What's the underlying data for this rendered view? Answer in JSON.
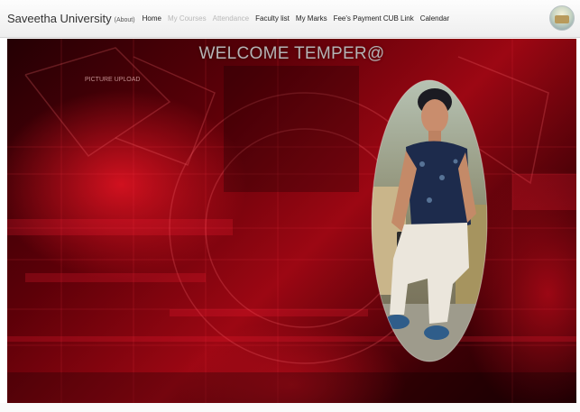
{
  "navbar": {
    "brand": "Saveetha University",
    "brand_sub": "(About)",
    "links": [
      {
        "label": "Home",
        "state": "active"
      },
      {
        "label": "My Courses",
        "state": "disabled"
      },
      {
        "label": "Attendance",
        "state": "disabled"
      },
      {
        "label": "Faculty list",
        "state": "active"
      },
      {
        "label": "My Marks",
        "state": "active"
      },
      {
        "label": "Fee's Payment CUB Link",
        "state": "active"
      },
      {
        "label": "Calendar",
        "state": "active"
      }
    ]
  },
  "hero": {
    "title": "WELCOME TEMPER@",
    "upload_link": "PICTURE UPLOAD"
  },
  "colors": {
    "hero_red": "#b5101f",
    "hero_dark": "#2a0004",
    "title_gray": "#b4b4b4",
    "disabled_link": "#b9b9b9"
  },
  "icons": {
    "avatar": "user-avatar-image",
    "profile_photo": "profile-photo"
  }
}
